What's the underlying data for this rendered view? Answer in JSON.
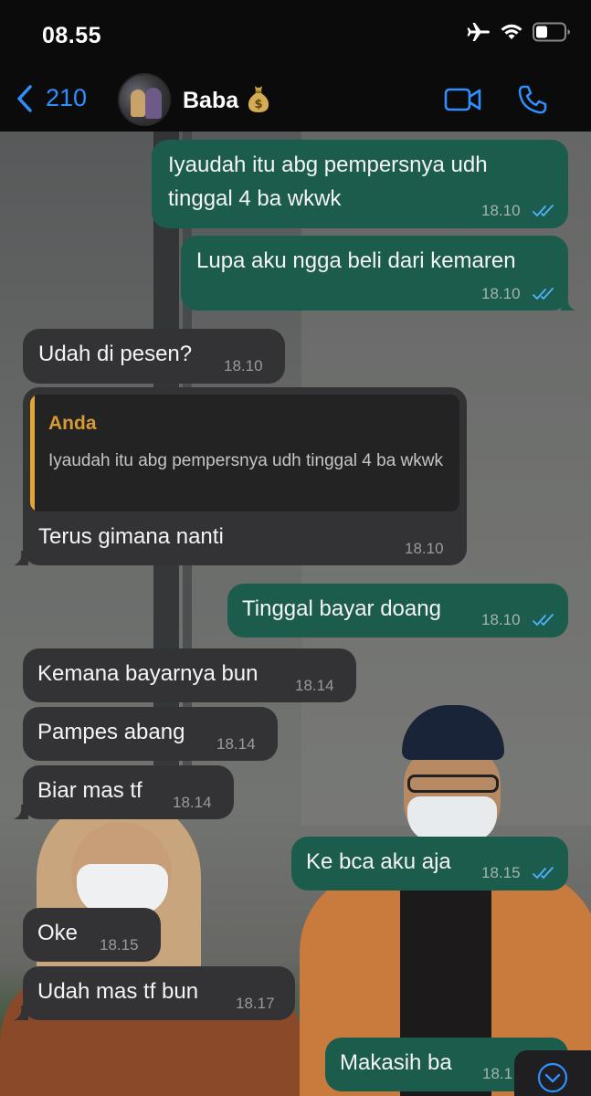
{
  "status_bar": {
    "time": "08.55",
    "icons": [
      "airplane-icon",
      "wifi-icon",
      "battery-icon"
    ]
  },
  "header": {
    "back_count": "210",
    "contact_name": "Baba",
    "contact_emoji": "money-bag-icon",
    "actions": [
      "video-call-icon",
      "phone-icon"
    ]
  },
  "colors": {
    "accent": "#2f8fff",
    "outgoing": "#1c5c4d",
    "incoming": "#333335",
    "quote_bar": "#e5a631",
    "read_ticks": "#4fb3ff"
  },
  "messages": [
    {
      "dir": "out",
      "lines": [
        "Iyaudah itu abg pempersnya udh",
        "tinggal 4 ba wkwk"
      ],
      "time": "18.10",
      "read": true
    },
    {
      "dir": "out",
      "lines": [
        "Lupa aku ngga beli dari kemaren"
      ],
      "time": "18.10",
      "read": true
    },
    {
      "dir": "in",
      "lines": [
        "Udah di pesen?"
      ],
      "time": "18.10"
    },
    {
      "dir": "in",
      "quote": {
        "name": "Anda",
        "text": "Iyaudah itu abg pempersnya udh tinggal 4 ba wkwk"
      },
      "lines": [
        "Terus gimana nanti"
      ],
      "time": "18.10"
    },
    {
      "dir": "out",
      "lines": [
        "Tinggal bayar doang"
      ],
      "time": "18.10",
      "read": true
    },
    {
      "dir": "in",
      "lines": [
        "Kemana bayarnya bun"
      ],
      "time": "18.14"
    },
    {
      "dir": "in",
      "lines": [
        "Pampes abang"
      ],
      "time": "18.14"
    },
    {
      "dir": "in",
      "lines": [
        "Biar mas tf"
      ],
      "time": "18.14"
    },
    {
      "dir": "out",
      "lines": [
        "Ke bca aku aja"
      ],
      "time": "18.15",
      "read": true
    },
    {
      "dir": "in",
      "lines": [
        "Oke"
      ],
      "time": "18.15"
    },
    {
      "dir": "in",
      "lines": [
        "Udah mas tf bun"
      ],
      "time": "18.17"
    },
    {
      "dir": "out",
      "lines": [
        "Makasih ba"
      ],
      "time": "18.1"
    }
  ],
  "scroll_button": "chevron-down-icon"
}
